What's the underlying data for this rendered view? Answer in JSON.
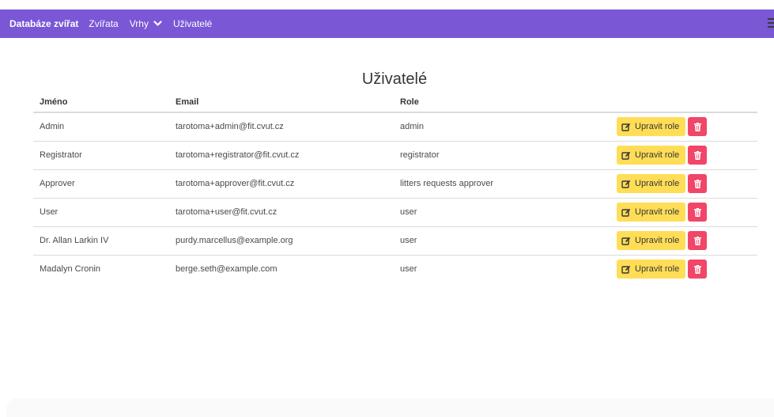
{
  "navbar": {
    "brand": "Databáze zvířat",
    "items": [
      {
        "label": "Zvířata"
      },
      {
        "label": "Vrhy"
      },
      {
        "label": "Uživatelé"
      }
    ],
    "color": "#7957d5"
  },
  "page": {
    "title": "Uživatelé"
  },
  "table": {
    "headers": {
      "name": "Jméno",
      "email": "Email",
      "role": "Role"
    },
    "edit_label": "Upravit role",
    "rows": [
      {
        "name": "Admin",
        "email": "tarotoma+admin@fit.cvut.cz",
        "role": "admin"
      },
      {
        "name": "Registrator",
        "email": "tarotoma+registrator@fit.cvut.cz",
        "role": "registrator"
      },
      {
        "name": "Approver",
        "email": "tarotoma+approver@fit.cvut.cz",
        "role": "litters requests approver"
      },
      {
        "name": "User",
        "email": "tarotoma+user@fit.cvut.cz",
        "role": "user"
      },
      {
        "name": "Dr. Allan Larkin IV",
        "email": "purdy.marcellus@example.org",
        "role": "user"
      },
      {
        "name": "Madalyn Cronin",
        "email": "berge.seth@example.com",
        "role": "user"
      }
    ]
  },
  "colors": {
    "edit_button": "#ffdd57",
    "delete_button": "#f14668"
  }
}
